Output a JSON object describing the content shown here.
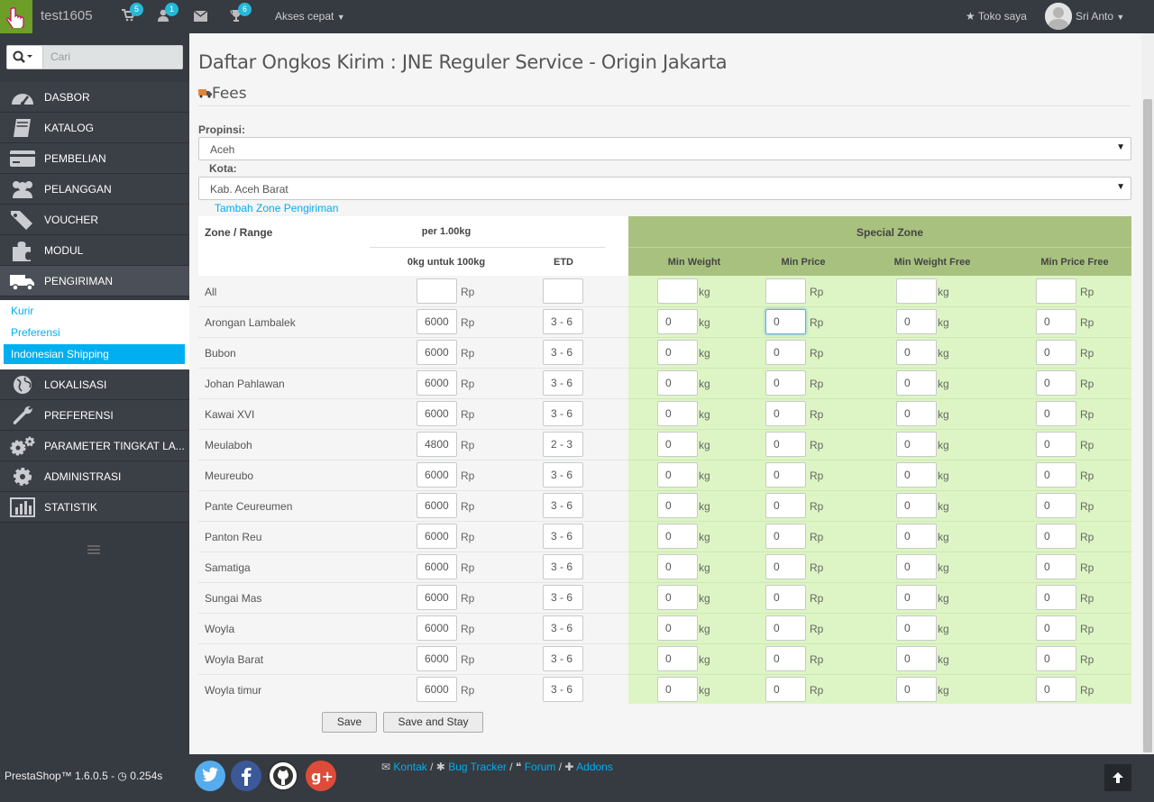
{
  "topbar": {
    "shop_name": "test1605",
    "badges": {
      "cart": "5",
      "customers": "1",
      "trophy": "6"
    },
    "quick_access": "Akses cepat",
    "shop_link": "Toko saya",
    "user_name": "Sri Anto"
  },
  "sidebar": {
    "search_placeholder": "Cari",
    "items": [
      {
        "label": "DASBOR",
        "icon": "dashboard-icon"
      },
      {
        "label": "KATALOG",
        "icon": "book-icon"
      },
      {
        "label": "PEMBELIAN",
        "icon": "credit-card-icon"
      },
      {
        "label": "PELANGGAN",
        "icon": "users-icon"
      },
      {
        "label": "VOUCHER",
        "icon": "tags-icon"
      },
      {
        "label": "MODUL",
        "icon": "puzzle-icon"
      },
      {
        "label": "PENGIRIMAN",
        "icon": "truck-icon"
      },
      {
        "label": "LOKALISASI",
        "icon": "globe-icon"
      },
      {
        "label": "PREFERENSI",
        "icon": "wrench-icon"
      },
      {
        "label": "PARAMETER TINGKAT LA...",
        "icon": "cogs-icon"
      },
      {
        "label": "ADMINISTRASI",
        "icon": "cog-icon"
      },
      {
        "label": "STATISTIK",
        "icon": "bar-chart-icon"
      }
    ],
    "submenu": [
      "Kurir",
      "Preferensi",
      "Indonesian Shipping"
    ]
  },
  "main": {
    "title": "Daftar Ongkos Kirim : JNE Reguler Service - Origin Jakarta",
    "section": "Fees",
    "province_label": "Propinsi:",
    "province_value": "Aceh",
    "city_label": "Kota:",
    "city_value": "Kab. Aceh Barat",
    "add_zone_link": "Tambah Zone Pengiriman",
    "table": {
      "col_zone": "Zone / Range",
      "col_per": "per 1.00kg",
      "col_range": "0kg untuk 100kg",
      "col_etd": "ETD",
      "special_zone": "Special Zone",
      "col_min_weight": "Min Weight",
      "col_min_price": "Min Price",
      "col_min_weight_free": "Min Weight Free",
      "col_min_price_free": "Min Price Free",
      "unit_rp": "Rp",
      "unit_kg": "kg",
      "rows": [
        {
          "name": "All",
          "price": "",
          "etd": "",
          "mw": "",
          "mp": "",
          "mwf": "",
          "mpf": ""
        },
        {
          "name": "Arongan Lambalek",
          "price": "6000",
          "etd": "3 - 6",
          "mw": "0",
          "mp": "0",
          "mwf": "0",
          "mpf": "0"
        },
        {
          "name": "Bubon",
          "price": "6000",
          "etd": "3 - 6",
          "mw": "0",
          "mp": "0",
          "mwf": "0",
          "mpf": "0"
        },
        {
          "name": "Johan Pahlawan",
          "price": "6000",
          "etd": "3 - 6",
          "mw": "0",
          "mp": "0",
          "mwf": "0",
          "mpf": "0"
        },
        {
          "name": "Kawai XVI",
          "price": "6000",
          "etd": "3 - 6",
          "mw": "0",
          "mp": "0",
          "mwf": "0",
          "mpf": "0"
        },
        {
          "name": "Meulaboh",
          "price": "4800",
          "etd": "2 - 3",
          "mw": "0",
          "mp": "0",
          "mwf": "0",
          "mpf": "0"
        },
        {
          "name": "Meureubo",
          "price": "6000",
          "etd": "3 - 6",
          "mw": "0",
          "mp": "0",
          "mwf": "0",
          "mpf": "0"
        },
        {
          "name": "Pante Ceureumen",
          "price": "6000",
          "etd": "3 - 6",
          "mw": "0",
          "mp": "0",
          "mwf": "0",
          "mpf": "0"
        },
        {
          "name": "Panton Reu",
          "price": "6000",
          "etd": "3 - 6",
          "mw": "0",
          "mp": "0",
          "mwf": "0",
          "mpf": "0"
        },
        {
          "name": "Samatiga",
          "price": "6000",
          "etd": "3 - 6",
          "mw": "0",
          "mp": "0",
          "mwf": "0",
          "mpf": "0"
        },
        {
          "name": "Sungai Mas",
          "price": "6000",
          "etd": "3 - 6",
          "mw": "0",
          "mp": "0",
          "mwf": "0",
          "mpf": "0"
        },
        {
          "name": "Woyla",
          "price": "6000",
          "etd": "3 - 6",
          "mw": "0",
          "mp": "0",
          "mwf": "0",
          "mpf": "0"
        },
        {
          "name": "Woyla Barat",
          "price": "6000",
          "etd": "3 - 6",
          "mw": "0",
          "mp": "0",
          "mwf": "0",
          "mpf": "0"
        },
        {
          "name": "Woyla timur",
          "price": "6000",
          "etd": "3 - 6",
          "mw": "0",
          "mp": "0",
          "mwf": "0",
          "mpf": "0"
        }
      ]
    },
    "save": "Save",
    "save_stay": "Save and Stay"
  },
  "footer": {
    "version": "PrestaShop™ 1.6.0.5 - ",
    "time": "0.254s",
    "links": [
      "Kontak",
      "Bug Tracker",
      "Forum",
      "Addons"
    ]
  },
  "colors": {
    "accent": "#00aff0",
    "sidebar": "#363a41",
    "special_zone_header": "#a9c17f",
    "special_zone_body": "#ddf5c4"
  }
}
